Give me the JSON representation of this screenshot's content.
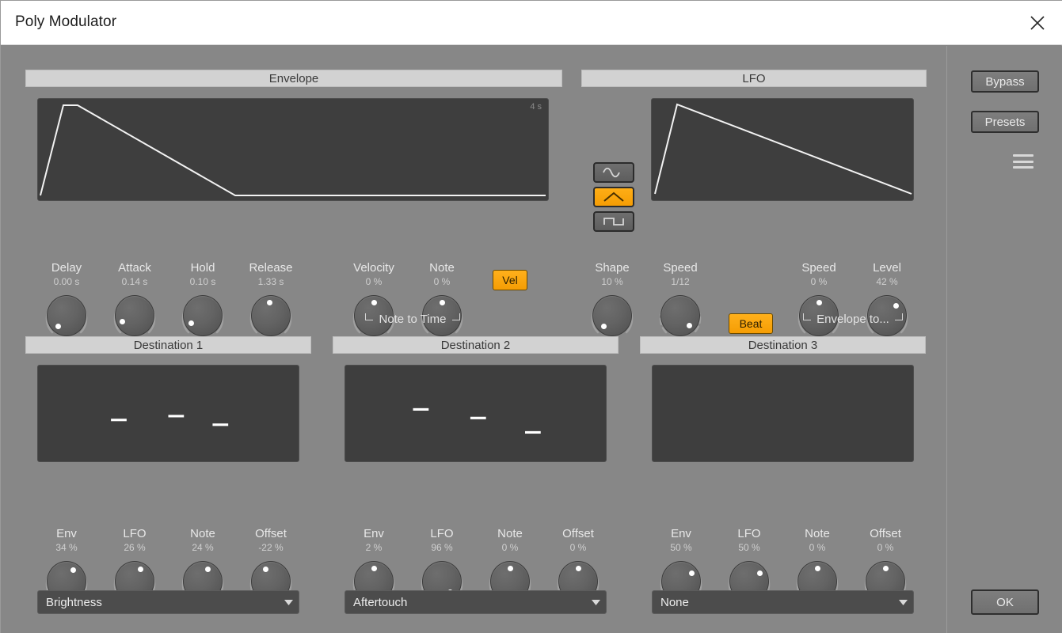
{
  "window": {
    "title": "Poly Modulator",
    "close_icon": "close-icon"
  },
  "envelope": {
    "header": "Envelope",
    "display_time_label": "4 s",
    "knobs": [
      {
        "label": "Delay",
        "value": "0.00 s",
        "angle": -143
      },
      {
        "label": "Attack",
        "value": "0.14 s",
        "angle": -118
      },
      {
        "label": "Hold",
        "value": "0.10 s",
        "angle": -122
      },
      {
        "label": "Release",
        "value": "1.33 s",
        "angle": -4
      }
    ],
    "mod_knobs": [
      {
        "label": "Velocity",
        "value": "0 %",
        "angle": 0
      },
      {
        "label": "Note",
        "value": "0 %",
        "angle": 0
      }
    ],
    "vel_button": "Vel",
    "note_to_time_label": "Note to Time"
  },
  "lfo": {
    "header": "LFO",
    "waveforms": [
      {
        "name": "sine-wave",
        "icon": "sine-wave-icon",
        "selected": false
      },
      {
        "name": "triangle-wave",
        "icon": "triangle-wave-icon",
        "selected": true
      },
      {
        "name": "square-wave",
        "icon": "square-wave-icon",
        "selected": false
      }
    ],
    "knobs": [
      {
        "label": "Shape",
        "value": "10 %",
        "angle": -140
      },
      {
        "label": "Speed",
        "value": "1/12",
        "angle": 137
      }
    ],
    "beat_button": "Beat",
    "env_knobs": [
      {
        "label": "Speed",
        "value": "0 %",
        "angle": 0
      },
      {
        "label": "Level",
        "value": "42 %",
        "angle": 42
      }
    ],
    "envelope_to_label": "Envelope to..."
  },
  "destinations": [
    {
      "header": "Destination 1",
      "knobs": [
        {
          "label": "Env",
          "value": "34 %",
          "angle": 30
        },
        {
          "label": "LFO",
          "value": "26 %",
          "angle": 25
        },
        {
          "label": "Note",
          "value": "24 %",
          "angle": 22
        },
        {
          "label": "Offset",
          "value": "-22 %",
          "angle": -22
        }
      ],
      "target": "Brightness",
      "markers": [
        {
          "x": 31,
          "y": 57
        },
        {
          "x": 53,
          "y": 53
        },
        {
          "x": 70,
          "y": 62
        }
      ]
    },
    {
      "header": "Destination 2",
      "knobs": [
        {
          "label": "Env",
          "value": "2 %",
          "angle": 2
        },
        {
          "label": "LFO",
          "value": "96 %",
          "angle": 143
        },
        {
          "label": "Note",
          "value": "0 %",
          "angle": 0
        },
        {
          "label": "Offset",
          "value": "0 %",
          "angle": 0
        }
      ],
      "target": "Aftertouch",
      "markers": [
        {
          "x": 29,
          "y": 46
        },
        {
          "x": 51,
          "y": 55
        },
        {
          "x": 72,
          "y": 70
        }
      ]
    },
    {
      "header": "Destination 3",
      "knobs": [
        {
          "label": "Env",
          "value": "50 %",
          "angle": 50
        },
        {
          "label": "LFO",
          "value": "50 %",
          "angle": 50
        },
        {
          "label": "Note",
          "value": "0 %",
          "angle": 0
        },
        {
          "label": "Offset",
          "value": "0 %",
          "angle": 0
        }
      ],
      "target": "None",
      "markers": []
    }
  ],
  "right_panel": {
    "bypass": "Bypass",
    "presets": "Presets",
    "menu_icon": "hamburger-menu-icon",
    "ok": "OK"
  },
  "colors": {
    "background": "#878787",
    "accent_orange": "#f5a004",
    "display_bg": "#3e3e3e",
    "header_bg": "#d2d2d2"
  }
}
